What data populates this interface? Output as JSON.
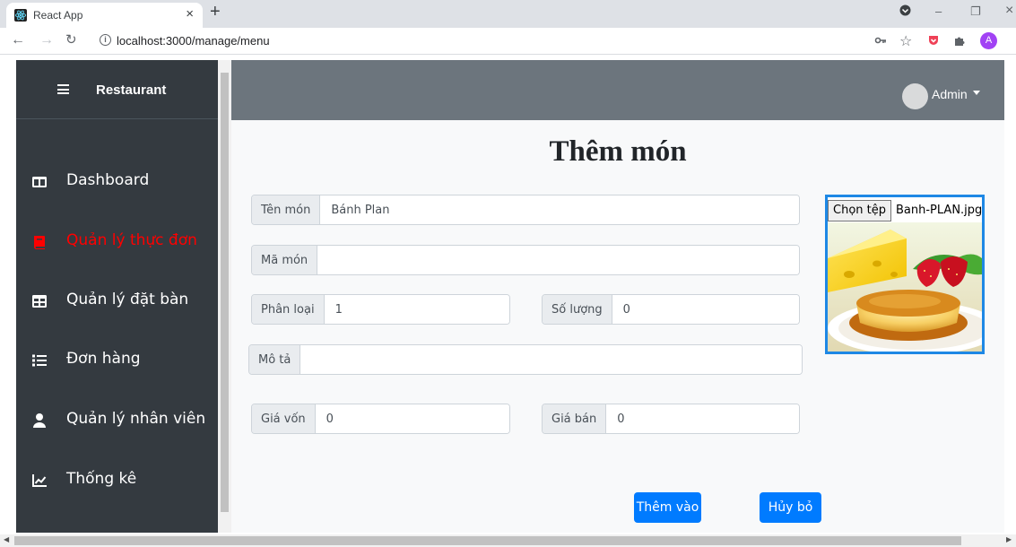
{
  "browser": {
    "tab_title": "React App",
    "tab_close": "×",
    "new_tab": "+",
    "url": "localhost:3000/manage/menu",
    "profile_initial": "A",
    "window_controls": {
      "minimize": "–",
      "restore": "❐",
      "close": "×"
    }
  },
  "sidebar": {
    "brand": "Restaurant",
    "items": [
      {
        "label": "Dashboard",
        "icon": "columns-icon"
      },
      {
        "label": "Quản lý thực đơn",
        "icon": "book-icon",
        "active": true
      },
      {
        "label": "Quản lý đặt bàn",
        "icon": "table-icon"
      },
      {
        "label": "Đơn hàng",
        "icon": "list-icon"
      },
      {
        "label": "Quản lý nhân viên",
        "icon": "user-icon"
      },
      {
        "label": "Thống kê",
        "icon": "chart-line-icon"
      }
    ]
  },
  "topnav": {
    "user": "Admin"
  },
  "form": {
    "title": "Thêm món",
    "fields": {
      "ten_mon": {
        "label": "Tên món",
        "value": "Bánh Plan"
      },
      "ma_mon": {
        "label": "Mã món",
        "value": ""
      },
      "phan_loai": {
        "label": "Phân loại",
        "value": "1"
      },
      "so_luong": {
        "label": "Số lượng",
        "value": "0"
      },
      "mo_ta": {
        "label": "Mô tả",
        "value": ""
      },
      "gia_von": {
        "label": "Giá vốn",
        "value": "0"
      },
      "gia_ban": {
        "label": "Giá bán",
        "value": "0"
      }
    },
    "file": {
      "button": "Chọn tệp",
      "filename": "Banh-PLAN.jpg"
    },
    "submit": "Thêm vào",
    "cancel": "Hủy bỏ"
  },
  "colors": {
    "sidebar_bg": "#343a40",
    "active_menu": "#ff0000",
    "topnav_bg": "#6c757d",
    "primary": "#007bff",
    "image_border": "#1e88e5"
  }
}
